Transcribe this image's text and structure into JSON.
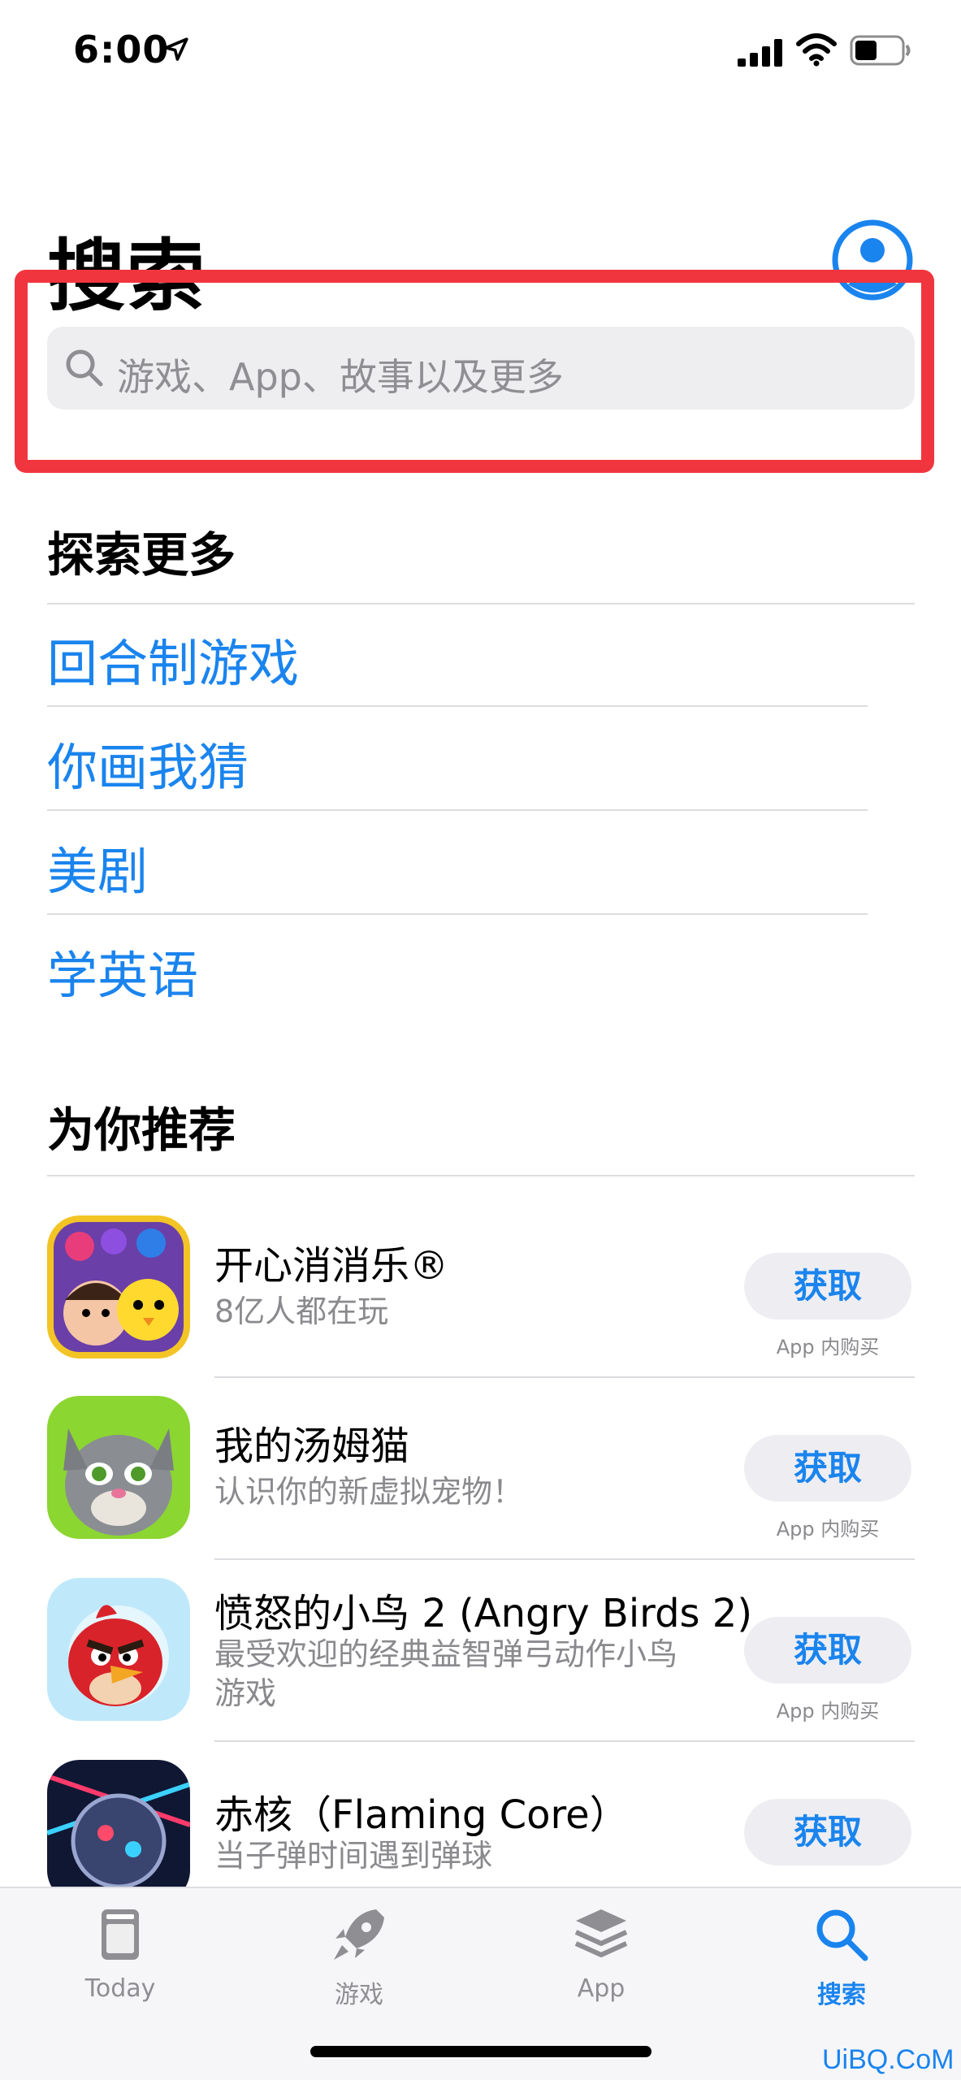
{
  "status_bar": {
    "time": "6:00"
  },
  "header": {
    "title": "搜索"
  },
  "search": {
    "placeholder": "游戏、App、故事以及更多"
  },
  "explore": {
    "title": "探索更多",
    "items": [
      "回合制游戏",
      "你画我猜",
      "美剧",
      "学英语"
    ]
  },
  "recommended": {
    "title": "为你推荐",
    "apps": [
      {
        "name": "开心消消乐®",
        "subtitle": "8亿人都在玩",
        "button": "获取",
        "note": "App 内购买"
      },
      {
        "name": "我的汤姆猫",
        "subtitle": "认识你的新虚拟宠物！",
        "button": "获取",
        "note": "App 内购买"
      },
      {
        "name": "愤怒的小鸟 2 (Angry Birds 2)",
        "subtitle": "最受欢迎的经典益智弹弓动作小鸟游戏",
        "button": "获取",
        "note": "App 内购买"
      },
      {
        "name": "赤核（Flaming Core）",
        "subtitle": "当子弹时间遇到弹球",
        "button": "获取"
      }
    ]
  },
  "tabs": [
    {
      "label": "Today",
      "icon": "today-icon"
    },
    {
      "label": "游戏",
      "icon": "rocket-icon"
    },
    {
      "label": "App",
      "icon": "app-stack-icon"
    },
    {
      "label": "搜索",
      "icon": "search-icon",
      "active": true
    }
  ],
  "watermark": "UiBQ.CoM",
  "colors": {
    "accent": "#1a84ee",
    "highlight": "#f0353e"
  }
}
